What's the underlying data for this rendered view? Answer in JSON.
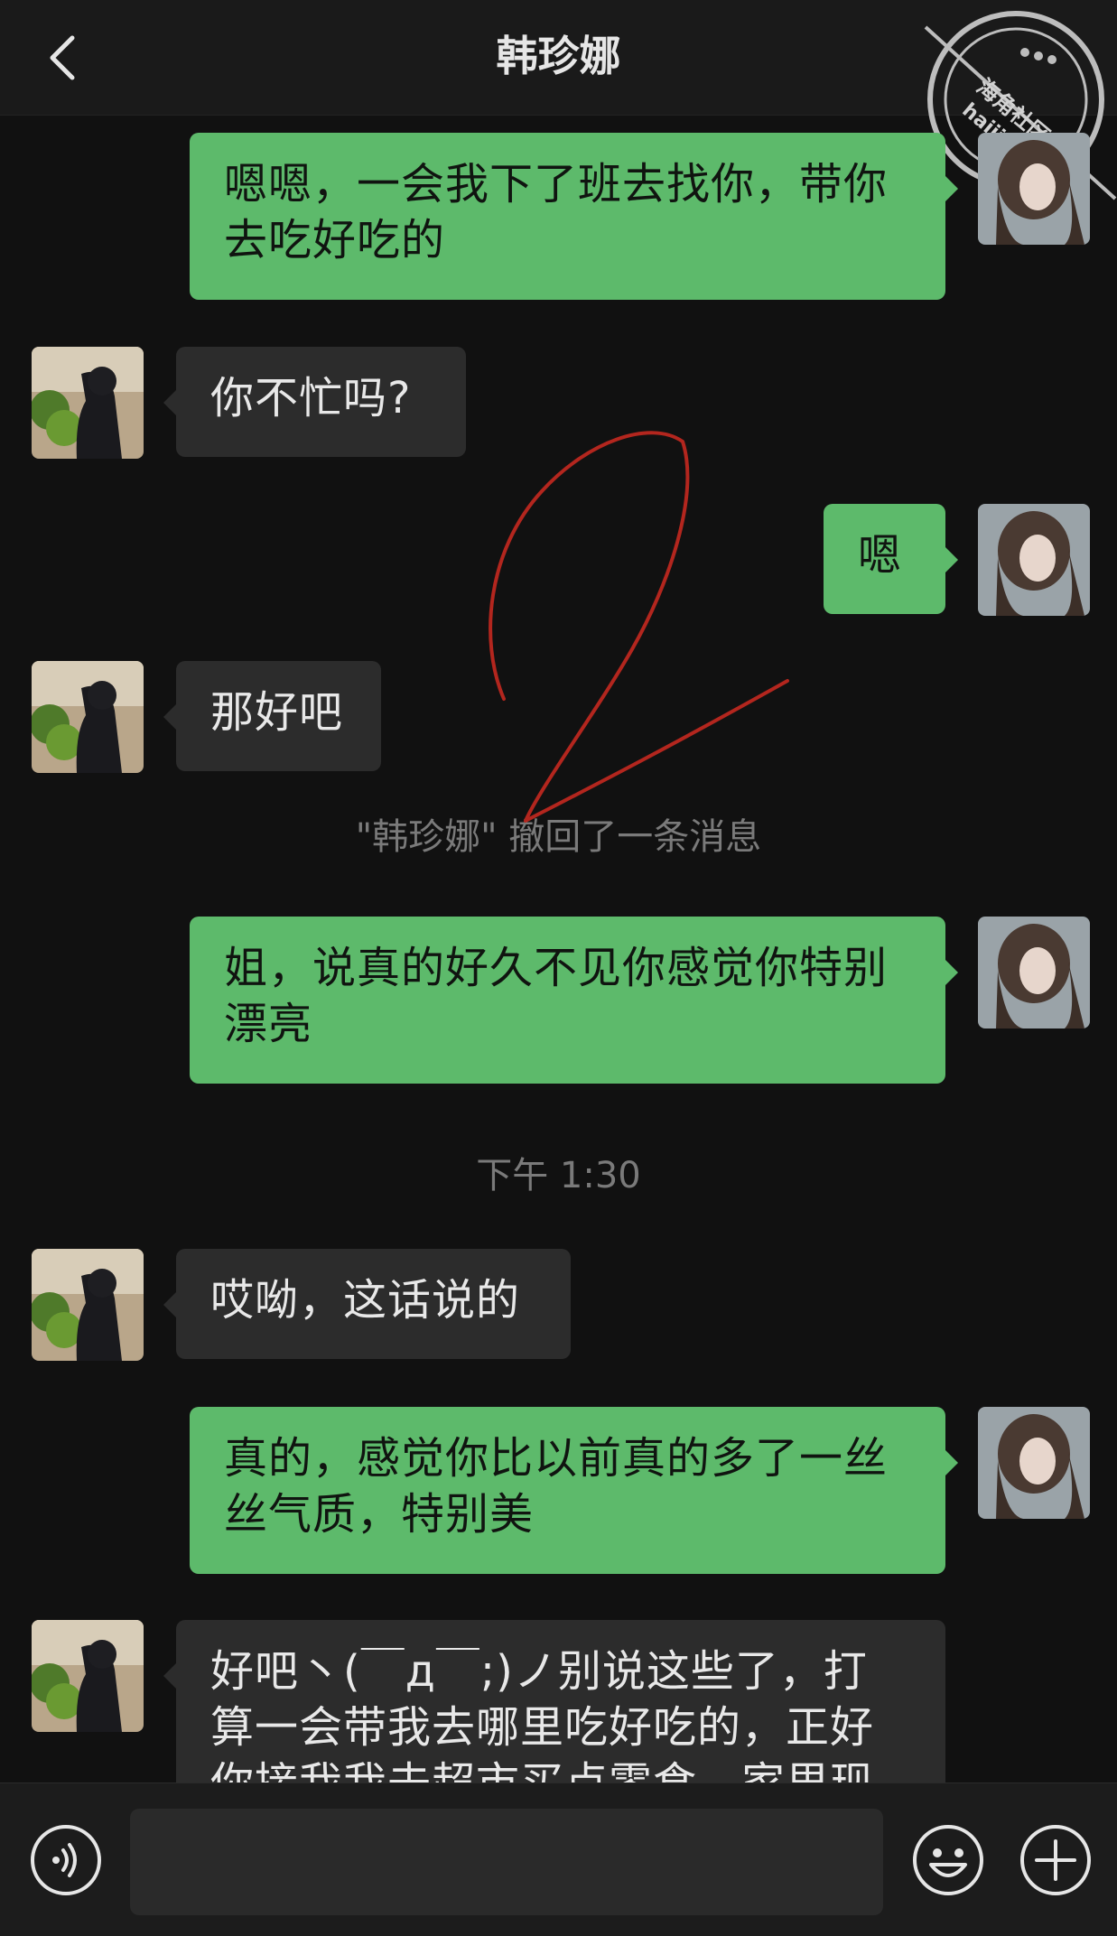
{
  "header": {
    "title": "韩珍娜",
    "back_icon": "chevron-left-icon"
  },
  "watermark": {
    "text": "海角社区",
    "url_text": "haijiao.com"
  },
  "messages": [
    {
      "side": "out",
      "text": "嗯嗯，一会我下了班去找你，带你去吃好吃的"
    },
    {
      "side": "in",
      "text": "你不忙吗?"
    },
    {
      "side": "out",
      "text": "嗯"
    },
    {
      "side": "in",
      "text": "那好吧"
    },
    {
      "side": "system",
      "text": "\"韩珍娜\" 撤回了一条消息"
    },
    {
      "side": "out",
      "text": "姐，说真的好久不见你感觉你特别漂亮"
    },
    {
      "side": "time",
      "text": "下午 1:30"
    },
    {
      "side": "in",
      "text": "哎呦，这话说的"
    },
    {
      "side": "out",
      "text": "真的，感觉你比以前真的多了一丝丝气质，特别美"
    },
    {
      "side": "in",
      "text": "好吧丶(￣д￣;)ノ别说这些了，打算一会带我去哪里吃好吃的，正好你接我我去超市买点零食，家里现在什么都没有"
    }
  ],
  "input_bar": {
    "placeholder": "",
    "value": "",
    "voice_icon": "voice-icon",
    "emoji_icon": "emoji-icon",
    "plus_icon": "plus-icon"
  },
  "colors": {
    "background": "#111111",
    "incoming_bubble": "#2c2c2c",
    "outgoing_bubble": "#5dba6b",
    "annotation_stroke": "#b3261e"
  }
}
